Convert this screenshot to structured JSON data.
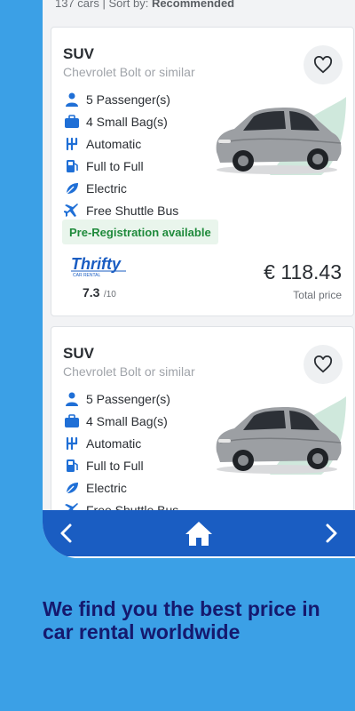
{
  "results": {
    "count_text": "137 cars",
    "separator": "|",
    "sort_label": "Sort by:",
    "sort_value": "Recommended"
  },
  "cards": [
    {
      "type": "SUV",
      "model": "Chevrolet Bolt or similar",
      "features": [
        {
          "icon": "person-icon",
          "label": "5 Passenger(s)"
        },
        {
          "icon": "bag-icon",
          "label": "4 Small Bag(s)"
        },
        {
          "icon": "gearshift-icon",
          "label": "Automatic"
        },
        {
          "icon": "fuel-icon",
          "label": "Full to Full"
        },
        {
          "icon": "leaf-icon",
          "label": "Electric"
        },
        {
          "icon": "plane-icon",
          "label": "Free Shuttle Bus"
        }
      ],
      "badge": "Pre-Registration available",
      "vendor": "Thrifty",
      "vendor_sub": "CAR RENTAL",
      "rating": "7.3",
      "rating_scale": "/10",
      "price": "€ 118.43",
      "price_label": "Total price"
    },
    {
      "type": "SUV",
      "model": "Chevrolet Bolt or similar",
      "features": [
        {
          "icon": "person-icon",
          "label": "5 Passenger(s)"
        },
        {
          "icon": "bag-icon",
          "label": "4 Small Bag(s)"
        },
        {
          "icon": "gearshift-icon",
          "label": "Automatic"
        },
        {
          "icon": "fuel-icon",
          "label": "Full to Full"
        },
        {
          "icon": "leaf-icon",
          "label": "Electric"
        },
        {
          "icon": "plane-icon",
          "label": "Free Shuttle Bus"
        }
      ]
    }
  ],
  "nav": {
    "back_icon": "chevron-left-icon",
    "home_icon": "home-icon",
    "forward_icon": "chevron-right-icon"
  },
  "tagline": "We find you the best price in car rental worldwide",
  "colors": {
    "background": "#3ba0e6",
    "nav": "#1a5dc2",
    "tagline": "#15196e",
    "icon_blue": "#1f6fd6",
    "badge_green": "#1f8a3b"
  }
}
